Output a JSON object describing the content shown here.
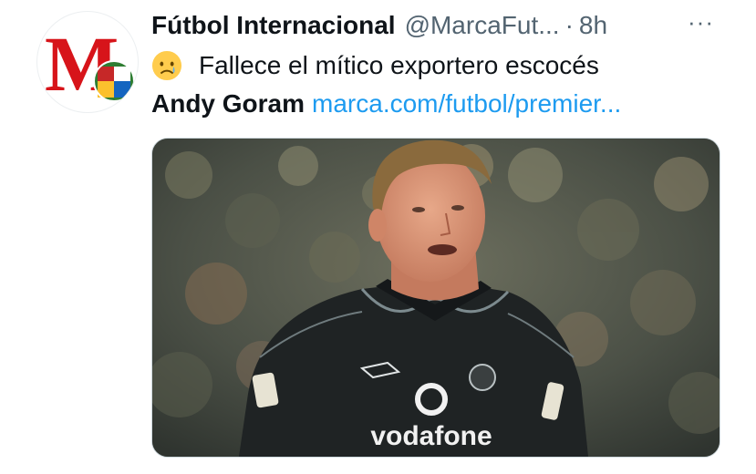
{
  "account": {
    "display_name": "Fútbol Internacional",
    "handle": "@MarcaFut...",
    "separator": "·",
    "timestamp": "8h",
    "avatar_letter": "M"
  },
  "more_label": "···",
  "tweet": {
    "emoji": "crying-face",
    "line1": "Fallece el mítico exportero escocés",
    "line2_bold": "Andy Goram",
    "link": "marca.com/futbol/premier..."
  },
  "media": {
    "shirt_text": "vodafone",
    "description": "goalkeeper photo"
  },
  "colors": {
    "link": "#1d9bf0",
    "muted": "#536471",
    "brand_red": "#d7141a"
  }
}
